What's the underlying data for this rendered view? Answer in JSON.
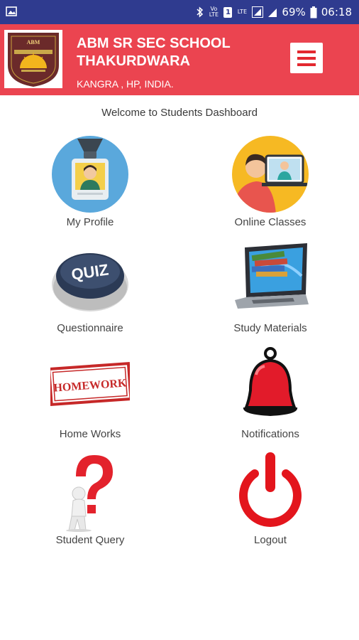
{
  "status_bar": {
    "battery": "69%",
    "time": "06:18",
    "volte": "Vo LTE",
    "lte": "LTE"
  },
  "header": {
    "logo_text": "ABM",
    "school_name_line1": "ABM SR SEC SCHOOL",
    "school_name_line2": "THAKURDWARA",
    "location": "KANGRA , HP, INDIA.",
    "brand_color": "#eb4450"
  },
  "dashboard": {
    "welcome": "Welcome to Students Dashboard",
    "tiles": [
      {
        "label": "My Profile",
        "icon": "id-badge-icon"
      },
      {
        "label": "Online Classes",
        "icon": "video-call-icon"
      },
      {
        "label": "Questionnaire",
        "icon": "quiz-button-icon",
        "icon_text": "QUIZ"
      },
      {
        "label": "Study Materials",
        "icon": "laptop-books-icon"
      },
      {
        "label": "Home Works",
        "icon": "homework-stamp-icon",
        "icon_text": "HOMEWORK"
      },
      {
        "label": "Notifications",
        "icon": "bell-icon"
      },
      {
        "label": "Student Query",
        "icon": "question-mark-figure-icon"
      },
      {
        "label": "Logout",
        "icon": "power-icon"
      }
    ]
  }
}
